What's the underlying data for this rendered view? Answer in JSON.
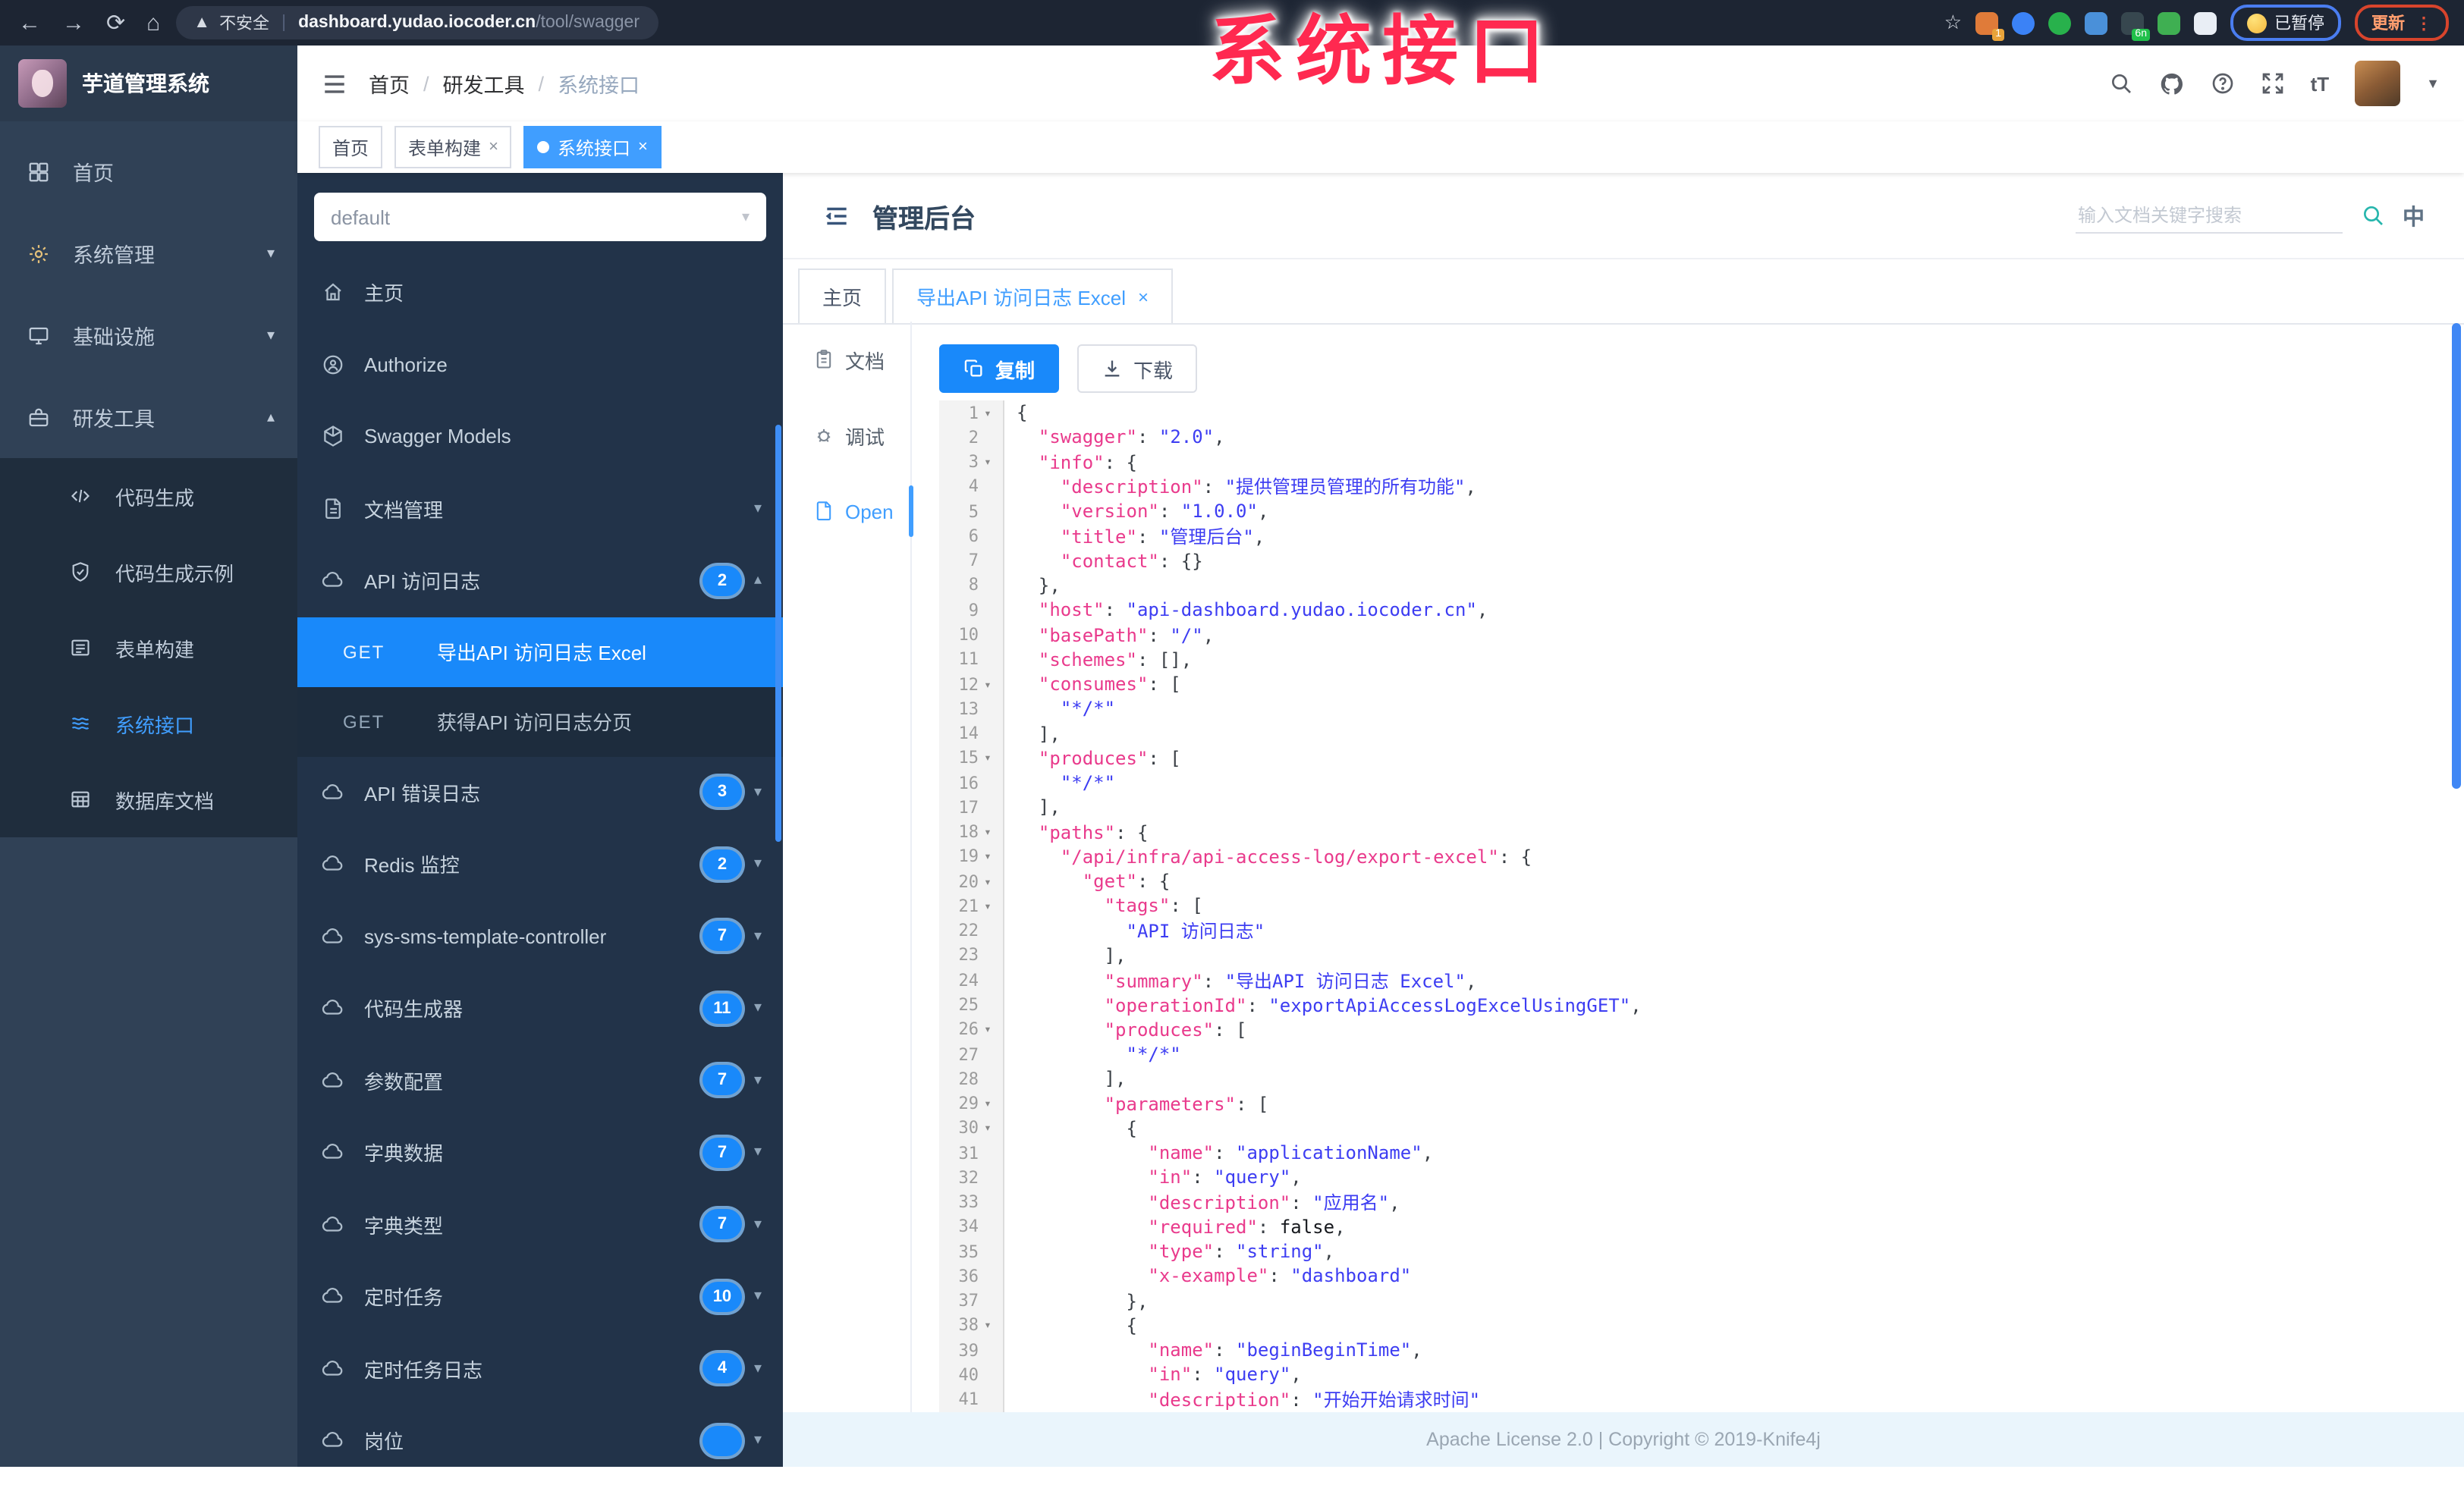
{
  "watermark": "系统接口",
  "browser": {
    "security_label": "不安全",
    "url_domain": "dashboard.yudao.iocoder.cn",
    "url_path": "/tool/swagger",
    "paused_label": "已暂停",
    "update_label": "更新",
    "extensions": [
      {
        "name": "ext-orange",
        "color": "#e07b39",
        "badge": "1",
        "badge_color": "#e8a33a"
      },
      {
        "name": "ext-blue-drop",
        "color": "#3b82f6",
        "badge": ""
      },
      {
        "name": "ext-green-circle",
        "color": "#28b14c",
        "badge": ""
      },
      {
        "name": "ext-blue-grid",
        "color": "#4a90d9",
        "badge": ""
      },
      {
        "name": "ext-dark",
        "color": "#37474f",
        "badge": "6n",
        "badge_color": "#21c04b"
      },
      {
        "name": "ext-green-leaf",
        "color": "#3faf52",
        "badge": ""
      },
      {
        "name": "ext-white-star",
        "color": "#e9eef5",
        "badge": ""
      }
    ]
  },
  "app_header": {
    "logo_title": "芋道管理系统",
    "breadcrumb": [
      "首页",
      "研发工具",
      "系统接口"
    ]
  },
  "tag_tabs": [
    {
      "label": "首页",
      "closable": false,
      "active": false
    },
    {
      "label": "表单构建",
      "closable": true,
      "active": false
    },
    {
      "label": "系统接口",
      "closable": true,
      "active": true
    }
  ],
  "sidebar": {
    "items": [
      {
        "label": "首页",
        "icon": "dashboard-icon"
      },
      {
        "label": "系统管理",
        "icon": "gear-icon",
        "chevron": "down"
      },
      {
        "label": "基础设施",
        "icon": "monitor-icon",
        "chevron": "down"
      },
      {
        "label": "研发工具",
        "icon": "toolbox-icon",
        "chevron": "up",
        "expanded": true,
        "children": [
          {
            "label": "代码生成",
            "icon": "code-icon"
          },
          {
            "label": "代码生成示例",
            "icon": "shield-icon"
          },
          {
            "label": "表单构建",
            "icon": "form-icon"
          },
          {
            "label": "系统接口",
            "icon": "swagger-icon",
            "active": true
          },
          {
            "label": "数据库文档",
            "icon": "database-icon"
          }
        ]
      }
    ]
  },
  "api_sidebar": {
    "group_select": {
      "value": "default"
    },
    "items": [
      {
        "type": "link",
        "label": "主页",
        "icon": "home-icon"
      },
      {
        "type": "link",
        "label": "Authorize",
        "icon": "lock-icon"
      },
      {
        "type": "link",
        "label": "Swagger Models",
        "icon": "models-icon"
      },
      {
        "type": "group",
        "label": "文档管理",
        "icon": "docs-icon",
        "chevron": "down"
      },
      {
        "type": "group",
        "label": "API 访问日志",
        "icon": "cloud-icon",
        "badge": "2",
        "chevron": "up",
        "children": [
          {
            "method": "GET",
            "label": "导出API 访问日志 Excel",
            "active": true
          },
          {
            "method": "GET",
            "label": "获得API 访问日志分页",
            "active": false
          }
        ]
      },
      {
        "type": "group",
        "label": "API 错误日志",
        "icon": "cloud-icon",
        "badge": "3",
        "chevron": "down"
      },
      {
        "type": "group",
        "label": "Redis 监控",
        "icon": "cloud-icon",
        "badge": "2",
        "chevron": "down"
      },
      {
        "type": "group",
        "label": "sys-sms-template-controller",
        "icon": "cloud-icon",
        "badge": "7",
        "chevron": "down"
      },
      {
        "type": "group",
        "label": "代码生成器",
        "icon": "cloud-icon",
        "badge": "11",
        "chevron": "down"
      },
      {
        "type": "group",
        "label": "参数配置",
        "icon": "cloud-icon",
        "badge": "7",
        "chevron": "down"
      },
      {
        "type": "group",
        "label": "字典数据",
        "icon": "cloud-icon",
        "badge": "7",
        "chevron": "down"
      },
      {
        "type": "group",
        "label": "字典类型",
        "icon": "cloud-icon",
        "badge": "7",
        "chevron": "down"
      },
      {
        "type": "group",
        "label": "定时任务",
        "icon": "cloud-icon",
        "badge": "10",
        "chevron": "down"
      },
      {
        "type": "group",
        "label": "定时任务日志",
        "icon": "cloud-icon",
        "badge": "4",
        "chevron": "down"
      },
      {
        "type": "group",
        "label": "岗位",
        "icon": "cloud-icon",
        "badge": "",
        "chevron": "down",
        "partial": true
      }
    ]
  },
  "doc": {
    "title": "管理后台",
    "search_placeholder": "输入文档关键字搜索",
    "lang_icon_label": "中",
    "tabs": [
      {
        "label": "主页",
        "closable": false,
        "active": false
      },
      {
        "label": "导出API 访问日志 Excel",
        "closable": true,
        "active": true
      }
    ],
    "nav": [
      {
        "label": "文档",
        "icon": "doc-icon",
        "active": false
      },
      {
        "label": "调试",
        "icon": "debug-icon",
        "active": false
      },
      {
        "label": "Open",
        "icon": "open-icon",
        "active": true
      }
    ],
    "toolbar": {
      "copy_label": "复制",
      "download_label": "下载"
    }
  },
  "code": {
    "lines": [
      {
        "n": 1,
        "fold": true,
        "seg": [
          [
            "p",
            "{"
          ]
        ]
      },
      {
        "n": 2,
        "fold": false,
        "seg": [
          [
            "p",
            "  "
          ],
          [
            "k",
            "\"swagger\""
          ],
          [
            "p",
            ": "
          ],
          [
            "s",
            "\"2.0\""
          ],
          [
            "p",
            ","
          ]
        ]
      },
      {
        "n": 3,
        "fold": true,
        "seg": [
          [
            "p",
            "  "
          ],
          [
            "k",
            "\"info\""
          ],
          [
            "p",
            ": {"
          ]
        ]
      },
      {
        "n": 4,
        "fold": false,
        "seg": [
          [
            "p",
            "    "
          ],
          [
            "k",
            "\"description\""
          ],
          [
            "p",
            ": "
          ],
          [
            "s",
            "\"提供管理员管理的所有功能\""
          ],
          [
            "p",
            ","
          ]
        ]
      },
      {
        "n": 5,
        "fold": false,
        "seg": [
          [
            "p",
            "    "
          ],
          [
            "k",
            "\"version\""
          ],
          [
            "p",
            ": "
          ],
          [
            "s",
            "\"1.0.0\""
          ],
          [
            "p",
            ","
          ]
        ]
      },
      {
        "n": 6,
        "fold": false,
        "seg": [
          [
            "p",
            "    "
          ],
          [
            "k",
            "\"title\""
          ],
          [
            "p",
            ": "
          ],
          [
            "s",
            "\"管理后台\""
          ],
          [
            "p",
            ","
          ]
        ]
      },
      {
        "n": 7,
        "fold": false,
        "seg": [
          [
            "p",
            "    "
          ],
          [
            "k",
            "\"contact\""
          ],
          [
            "p",
            ": {}"
          ]
        ]
      },
      {
        "n": 8,
        "fold": false,
        "seg": [
          [
            "p",
            "  },"
          ]
        ]
      },
      {
        "n": 9,
        "fold": false,
        "seg": [
          [
            "p",
            "  "
          ],
          [
            "k",
            "\"host\""
          ],
          [
            "p",
            ": "
          ],
          [
            "s",
            "\"api-dashboard.yudao.iocoder.cn\""
          ],
          [
            "p",
            ","
          ]
        ]
      },
      {
        "n": 10,
        "fold": false,
        "seg": [
          [
            "p",
            "  "
          ],
          [
            "k",
            "\"basePath\""
          ],
          [
            "p",
            ": "
          ],
          [
            "s",
            "\"/\""
          ],
          [
            "p",
            ","
          ]
        ]
      },
      {
        "n": 11,
        "fold": false,
        "seg": [
          [
            "p",
            "  "
          ],
          [
            "k",
            "\"schemes\""
          ],
          [
            "p",
            ": [],"
          ]
        ]
      },
      {
        "n": 12,
        "fold": true,
        "seg": [
          [
            "p",
            "  "
          ],
          [
            "k",
            "\"consumes\""
          ],
          [
            "p",
            ": ["
          ]
        ]
      },
      {
        "n": 13,
        "fold": false,
        "seg": [
          [
            "p",
            "    "
          ],
          [
            "s",
            "\"*/*\""
          ]
        ]
      },
      {
        "n": 14,
        "fold": false,
        "seg": [
          [
            "p",
            "  ],"
          ]
        ]
      },
      {
        "n": 15,
        "fold": true,
        "seg": [
          [
            "p",
            "  "
          ],
          [
            "k",
            "\"produces\""
          ],
          [
            "p",
            ": ["
          ]
        ]
      },
      {
        "n": 16,
        "fold": false,
        "seg": [
          [
            "p",
            "    "
          ],
          [
            "s",
            "\"*/*\""
          ]
        ]
      },
      {
        "n": 17,
        "fold": false,
        "seg": [
          [
            "p",
            "  ],"
          ]
        ]
      },
      {
        "n": 18,
        "fold": true,
        "seg": [
          [
            "p",
            "  "
          ],
          [
            "k",
            "\"paths\""
          ],
          [
            "p",
            ": {"
          ]
        ]
      },
      {
        "n": 19,
        "fold": true,
        "seg": [
          [
            "p",
            "    "
          ],
          [
            "k",
            "\"/api/infra/api-access-log/export-excel\""
          ],
          [
            "p",
            ": {"
          ]
        ]
      },
      {
        "n": 20,
        "fold": true,
        "seg": [
          [
            "p",
            "      "
          ],
          [
            "k",
            "\"get\""
          ],
          [
            "p",
            ": {"
          ]
        ]
      },
      {
        "n": 21,
        "fold": true,
        "seg": [
          [
            "p",
            "        "
          ],
          [
            "k",
            "\"tags\""
          ],
          [
            "p",
            ": ["
          ]
        ]
      },
      {
        "n": 22,
        "fold": false,
        "seg": [
          [
            "p",
            "          "
          ],
          [
            "s",
            "\"API 访问日志\""
          ]
        ]
      },
      {
        "n": 23,
        "fold": false,
        "seg": [
          [
            "p",
            "        ],"
          ]
        ]
      },
      {
        "n": 24,
        "fold": false,
        "seg": [
          [
            "p",
            "        "
          ],
          [
            "k",
            "\"summary\""
          ],
          [
            "p",
            ": "
          ],
          [
            "s",
            "\"导出API 访问日志 Excel\""
          ],
          [
            "p",
            ","
          ]
        ]
      },
      {
        "n": 25,
        "fold": false,
        "seg": [
          [
            "p",
            "        "
          ],
          [
            "k",
            "\"operationId\""
          ],
          [
            "p",
            ": "
          ],
          [
            "s",
            "\"exportApiAccessLogExcelUsingGET\""
          ],
          [
            "p",
            ","
          ]
        ]
      },
      {
        "n": 26,
        "fold": true,
        "seg": [
          [
            "p",
            "        "
          ],
          [
            "k",
            "\"produces\""
          ],
          [
            "p",
            ": ["
          ]
        ]
      },
      {
        "n": 27,
        "fold": false,
        "seg": [
          [
            "p",
            "          "
          ],
          [
            "s",
            "\"*/*\""
          ]
        ]
      },
      {
        "n": 28,
        "fold": false,
        "seg": [
          [
            "p",
            "        ],"
          ]
        ]
      },
      {
        "n": 29,
        "fold": true,
        "seg": [
          [
            "p",
            "        "
          ],
          [
            "k",
            "\"parameters\""
          ],
          [
            "p",
            ": ["
          ]
        ]
      },
      {
        "n": 30,
        "fold": true,
        "seg": [
          [
            "p",
            "          {"
          ]
        ]
      },
      {
        "n": 31,
        "fold": false,
        "seg": [
          [
            "p",
            "            "
          ],
          [
            "k",
            "\"name\""
          ],
          [
            "p",
            ": "
          ],
          [
            "s",
            "\"applicationName\""
          ],
          [
            "p",
            ","
          ]
        ]
      },
      {
        "n": 32,
        "fold": false,
        "seg": [
          [
            "p",
            "            "
          ],
          [
            "k",
            "\"in\""
          ],
          [
            "p",
            ": "
          ],
          [
            "s",
            "\"query\""
          ],
          [
            "p",
            ","
          ]
        ]
      },
      {
        "n": 33,
        "fold": false,
        "seg": [
          [
            "p",
            "            "
          ],
          [
            "k",
            "\"description\""
          ],
          [
            "p",
            ": "
          ],
          [
            "s",
            "\"应用名\""
          ],
          [
            "p",
            ","
          ]
        ]
      },
      {
        "n": 34,
        "fold": false,
        "seg": [
          [
            "p",
            "            "
          ],
          [
            "k",
            "\"required\""
          ],
          [
            "p",
            ": "
          ],
          [
            "b",
            "false"
          ],
          [
            "p",
            ","
          ]
        ]
      },
      {
        "n": 35,
        "fold": false,
        "seg": [
          [
            "p",
            "            "
          ],
          [
            "k",
            "\"type\""
          ],
          [
            "p",
            ": "
          ],
          [
            "s",
            "\"string\""
          ],
          [
            "p",
            ","
          ]
        ]
      },
      {
        "n": 36,
        "fold": false,
        "seg": [
          [
            "p",
            "            "
          ],
          [
            "k",
            "\"x-example\""
          ],
          [
            "p",
            ": "
          ],
          [
            "s",
            "\"dashboard\""
          ]
        ]
      },
      {
        "n": 37,
        "fold": false,
        "seg": [
          [
            "p",
            "          },"
          ]
        ]
      },
      {
        "n": 38,
        "fold": true,
        "seg": [
          [
            "p",
            "          {"
          ]
        ]
      },
      {
        "n": 39,
        "fold": false,
        "seg": [
          [
            "p",
            "            "
          ],
          [
            "k",
            "\"name\""
          ],
          [
            "p",
            ": "
          ],
          [
            "s",
            "\"beginBeginTime\""
          ],
          [
            "p",
            ","
          ]
        ]
      },
      {
        "n": 40,
        "fold": false,
        "seg": [
          [
            "p",
            "            "
          ],
          [
            "k",
            "\"in\""
          ],
          [
            "p",
            ": "
          ],
          [
            "s",
            "\"query\""
          ],
          [
            "p",
            ","
          ]
        ]
      },
      {
        "n": 41,
        "fold": false,
        "seg": [
          [
            "p",
            "            "
          ],
          [
            "k",
            "\"description\""
          ],
          [
            "p",
            ": "
          ],
          [
            "s",
            "\"开始开始请求时间\""
          ]
        ]
      }
    ]
  },
  "footer": {
    "text": "Apache License 2.0 | Copyright © 2019-Knife4j"
  }
}
